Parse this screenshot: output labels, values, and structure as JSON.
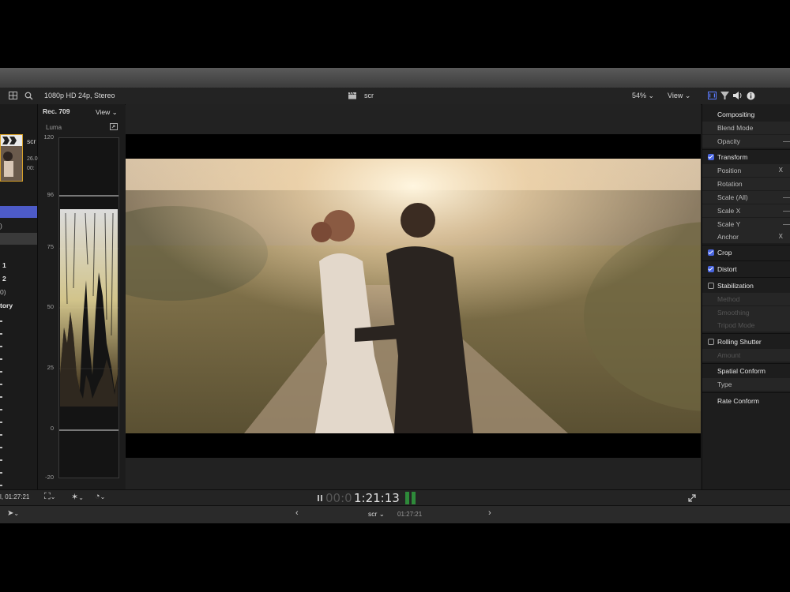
{
  "toolbar": {
    "format": "1080p HD 24p, Stereo",
    "clip_name": "scr",
    "zoom": "54%",
    "view_label": "View"
  },
  "scopes": {
    "color_space": "Rec. 709",
    "view_label": "View",
    "scope_type": "Luma",
    "ticks": [
      "120",
      "96",
      "75",
      "50",
      "25",
      "0",
      "-20"
    ]
  },
  "browser": {
    "clip_name": "scr",
    "clip_meta_1": "26.0",
    "clip_meta_2": "00:",
    "items": [
      ")",
      "1",
      "2",
      "0)",
      "tory"
    ],
    "duration": "l, 01:27:21"
  },
  "inspector": {
    "compositing": "Compositing",
    "blend_mode": "Blend Mode",
    "opacity": "Opacity",
    "transform": "Transform",
    "position": "Position",
    "position_x": "X",
    "rotation": "Rotation",
    "scale_all": "Scale (All)",
    "scale_x": "Scale X",
    "scale_y": "Scale Y",
    "anchor": "Anchor",
    "anchor_x": "X",
    "crop": "Crop",
    "distort": "Distort",
    "stabilization": "Stabilization",
    "method": "Method",
    "smoothing": "Smoothing",
    "tripod_mode": "Tripod Mode",
    "rolling_shutter": "Rolling Shutter",
    "amount": "Amount",
    "spatial_conform": "Spatial Conform",
    "type": "Type",
    "rate_conform": "Rate Conform"
  },
  "playback": {
    "timecode_dim": "00:0",
    "timecode": "1:21:13"
  },
  "timeline": {
    "project": "scr",
    "duration": "01:27:21"
  },
  "colors": {
    "accent": "#4a66e0",
    "panel": "#1d1d1d"
  }
}
